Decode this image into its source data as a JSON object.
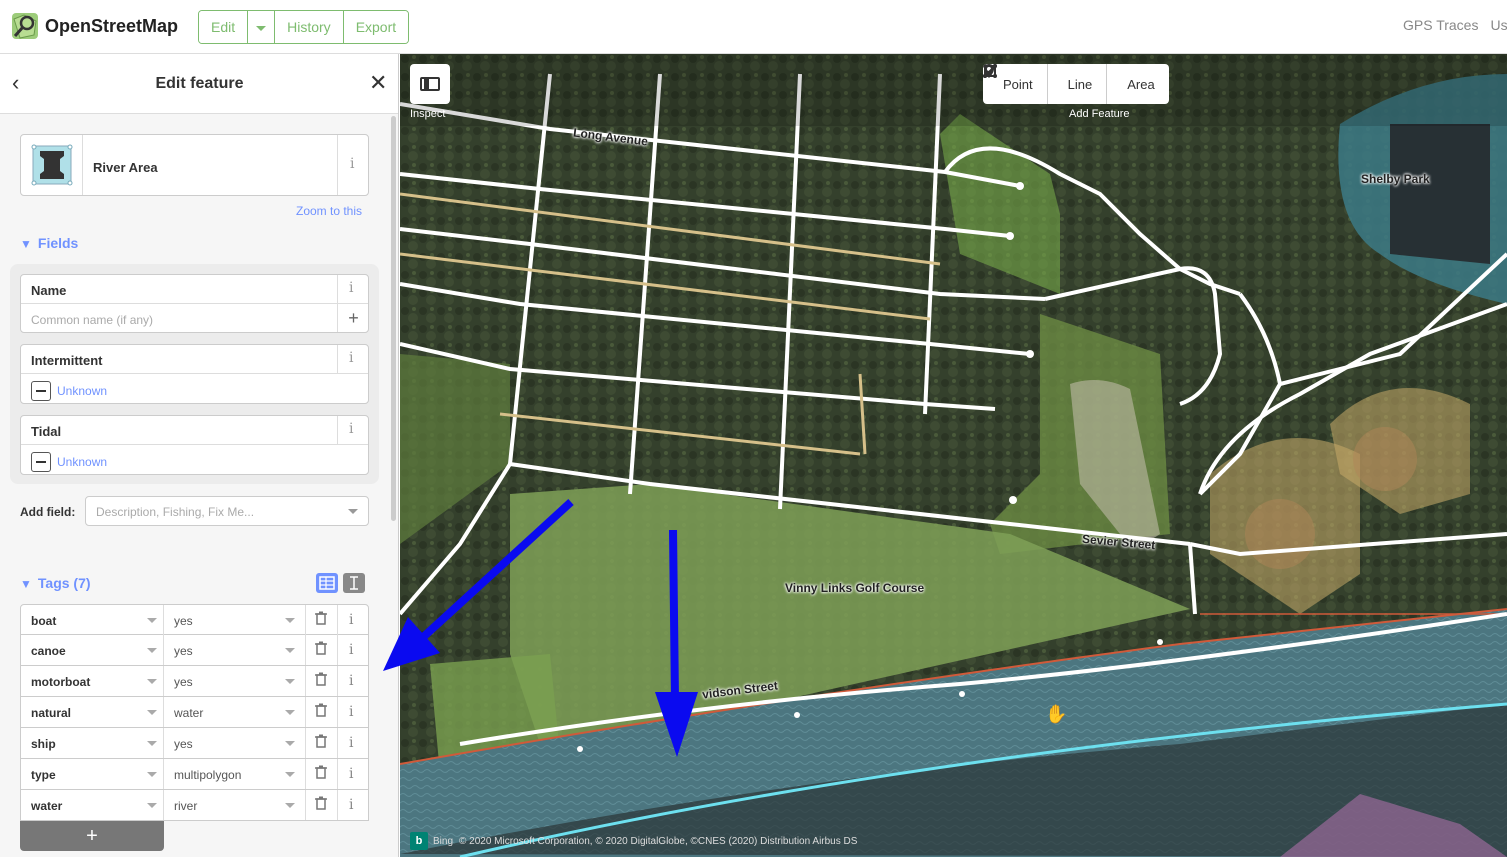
{
  "header": {
    "brand": "OpenStreetMap",
    "edit_label": "Edit",
    "history_label": "History",
    "export_label": "Export",
    "right_links": [
      "GPS Traces",
      "Us"
    ]
  },
  "sidebar": {
    "title": "Edit feature",
    "back_icon": "‹",
    "close_icon": "✕",
    "preset_name": "River Area",
    "zoom_link": "Zoom to this",
    "fields_heading": "Fields",
    "fields": {
      "name": {
        "label": "Name",
        "placeholder": "Common name (if any)"
      },
      "intermittent": {
        "label": "Intermittent",
        "value": "Unknown"
      },
      "tidal": {
        "label": "Tidal",
        "value": "Unknown"
      }
    },
    "add_field_label": "Add field:",
    "add_field_placeholder": "Description, Fishing, Fix Me...",
    "tags_heading": "Tags (7)",
    "tags": [
      {
        "key": "boat",
        "value": "yes"
      },
      {
        "key": "canoe",
        "value": "yes"
      },
      {
        "key": "motorboat",
        "value": "yes"
      },
      {
        "key": "natural",
        "value": "water"
      },
      {
        "key": "ship",
        "value": "yes"
      },
      {
        "key": "type",
        "value": "multipolygon"
      },
      {
        "key": "water",
        "value": "river"
      }
    ],
    "add_tag_icon": "+"
  },
  "map": {
    "inspect_label": "Inspect",
    "add_feature_label": "Add Feature",
    "tools": {
      "point": "Point",
      "line": "Line",
      "area": "Area"
    },
    "labels": {
      "long_avenue": "Long Avenue",
      "shelby_park": "Shelby Park",
      "golf_course": "Vinny Links Golf Course",
      "sevier_street": "Sevier Street",
      "davidson_street": "vidson Street"
    },
    "attribution_logo": "b",
    "attribution_bing": "Bing",
    "attribution": "© 2020 Microsoft Corporation, © 2020 DigitalGlobe, ©CNES (2020) Distribution Airbus DS"
  },
  "colors": {
    "osm_green": "#7ebc6f",
    "link_blue": "#7092ff",
    "river_fill": "#4a7a86",
    "river_line": "#6de0ef",
    "annotation_arrow": "#0a0af0"
  }
}
